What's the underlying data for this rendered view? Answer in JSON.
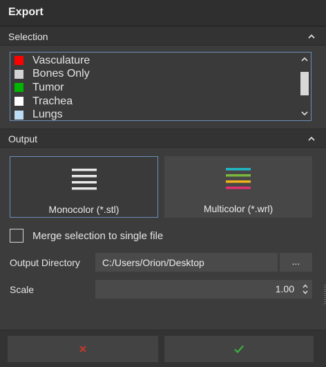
{
  "window": {
    "title": "Export"
  },
  "selection": {
    "header": "Selection",
    "items": [
      {
        "label": "Vasculature",
        "color": "#ff0000"
      },
      {
        "label": "Bones Only",
        "color": "#d3d3d3"
      },
      {
        "label": "Tumor",
        "color": "#00b400"
      },
      {
        "label": "Trachea",
        "color": "#ffffff"
      },
      {
        "label": "Lungs",
        "color": "#bcdcf5"
      }
    ]
  },
  "output": {
    "header": "Output",
    "formats": [
      {
        "label": "Monocolor (*.stl)",
        "icon": "monocolor-lines-icon",
        "selected": true
      },
      {
        "label": "Multicolor (*.wrl)",
        "icon": "multicolor-lines-icon",
        "selected": false
      }
    ],
    "multicolor_colors": [
      "#21b8c4",
      "#7ab83c",
      "#f0b21b",
      "#e02f72"
    ],
    "merge_label": "Merge selection to single file",
    "merge_checked": false,
    "directory_label": "Output Directory",
    "directory_value": "C:/Users/Orion/Desktop",
    "browse_label": "...",
    "scale_label": "Scale",
    "scale_value": "1.00"
  },
  "actions": {
    "cancel_icon": "x-icon",
    "cancel_color": "#c0392b",
    "ok_icon": "checkmark-icon",
    "ok_color": "#3cb043"
  }
}
